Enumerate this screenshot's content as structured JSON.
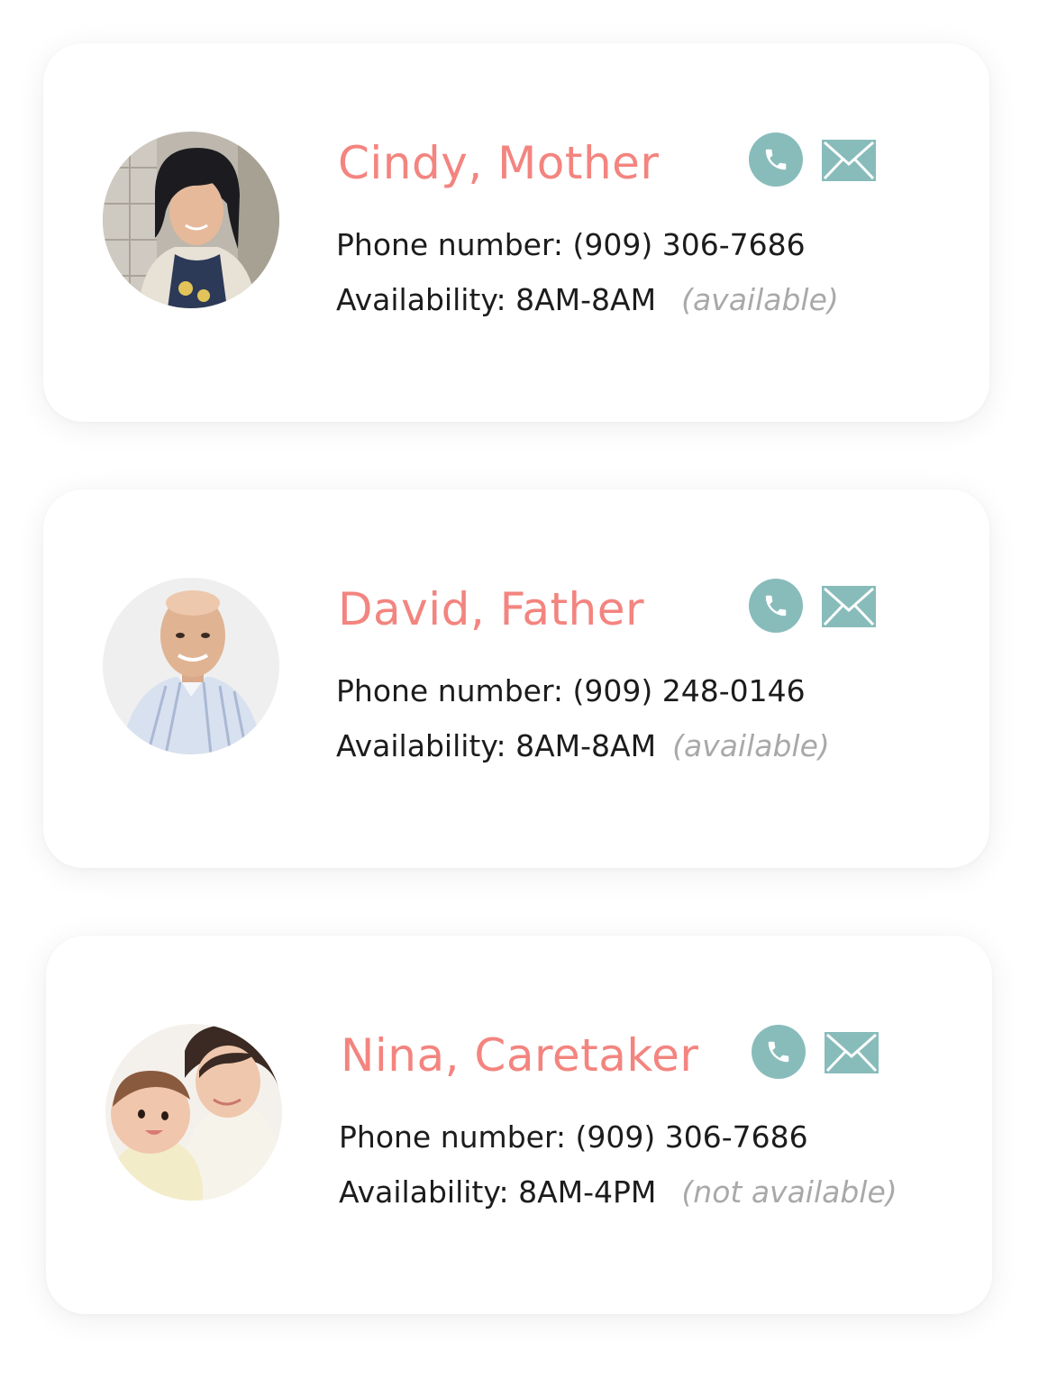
{
  "contacts": [
    {
      "name": "Cindy, Mother",
      "phone": "Phone number:  (909) 306-7686",
      "availability": "Availability: 8AM-8AM",
      "status": "(available)"
    },
    {
      "name": "David, Father",
      "phone": "Phone number:  (909) 248-0146",
      "availability": "Availability: 8AM-8AM",
      "status": "(available)"
    },
    {
      "name": "Nina, Caretaker",
      "phone": "Phone number:  (909) 306-7686",
      "availability": "Availability: 8AM-4PM",
      "status": "(not available)"
    }
  ],
  "colors": {
    "name": "#f3847f",
    "accent": "#88bcbb",
    "status": "#a9a9a9",
    "text": "#1c1c1c"
  },
  "icons": {
    "call": "phone-icon",
    "mail": "mail-icon"
  }
}
